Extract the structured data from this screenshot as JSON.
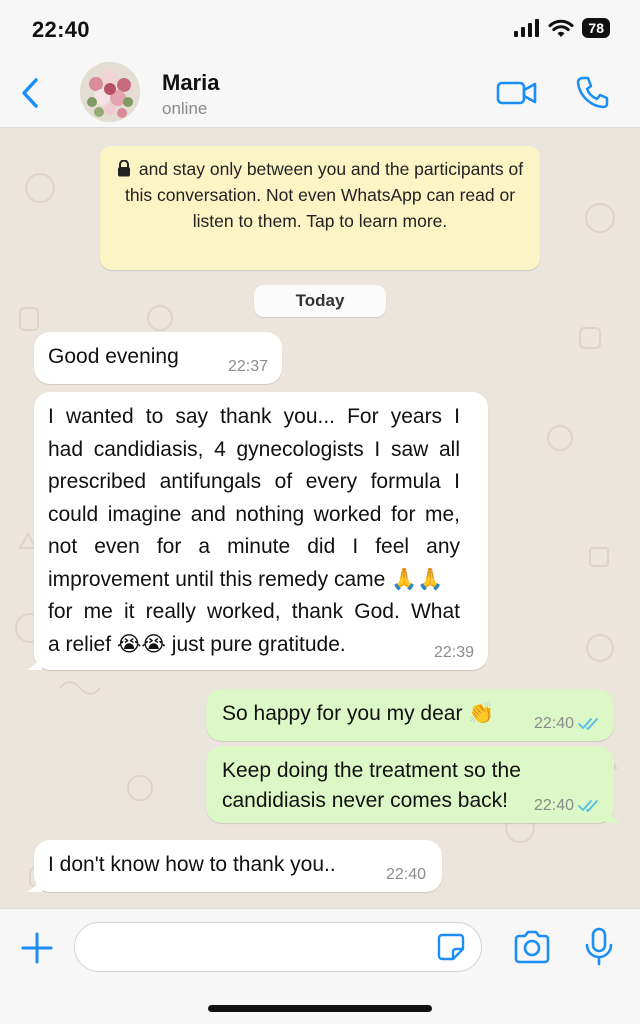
{
  "status_bar": {
    "time": "22:40",
    "battery": "78"
  },
  "contact": {
    "name": "Maria",
    "status": "online"
  },
  "encryption_notice": "and stay only between you and the participants of this conversation. Not even WhatsApp can read or listen to them. Tap to learn more.",
  "date_divider": "Today",
  "messages": [
    {
      "direction": "incoming",
      "text": "Good evening",
      "time": "22:37"
    },
    {
      "direction": "incoming",
      "lines": [
        "I wanted to say thank you... For years I",
        "had candidiasis, 4 gynecologists I saw all",
        "prescribed antifungals of every formula I",
        "could imagine and nothing worked for me,",
        "not even for a minute did I feel any",
        "improvement until this remedy came 🙏🙏",
        "for me it really worked, thank God. What",
        "a relief 😭😭 just pure gratitude."
      ],
      "time": "22:39"
    },
    {
      "direction": "outgoing",
      "text": "So happy for you my dear 👏",
      "time": "22:40",
      "read": true
    },
    {
      "direction": "outgoing",
      "lines": [
        "Keep doing the treatment so the",
        "candidiasis never comes back!"
      ],
      "time": "22:40",
      "read": true
    },
    {
      "direction": "incoming",
      "text": "I don't know how to thank you..",
      "time": "22:40"
    }
  ],
  "composer": {
    "placeholder": ""
  },
  "colors": {
    "accent": "#1b8ef8",
    "incoming_bubble": "#ffffff",
    "outgoing_bubble": "#dcf8c6",
    "read_tick": "#53bdeb",
    "encryption_banner": "#fdf4c5",
    "wallpaper": "#ece5dd"
  },
  "icons": [
    "back-chevron-icon",
    "video-call-icon",
    "phone-icon",
    "lock-icon",
    "double-check-icon",
    "plus-icon",
    "sticker-icon",
    "camera-icon",
    "microphone-icon",
    "signal-icon",
    "wifi-icon"
  ]
}
